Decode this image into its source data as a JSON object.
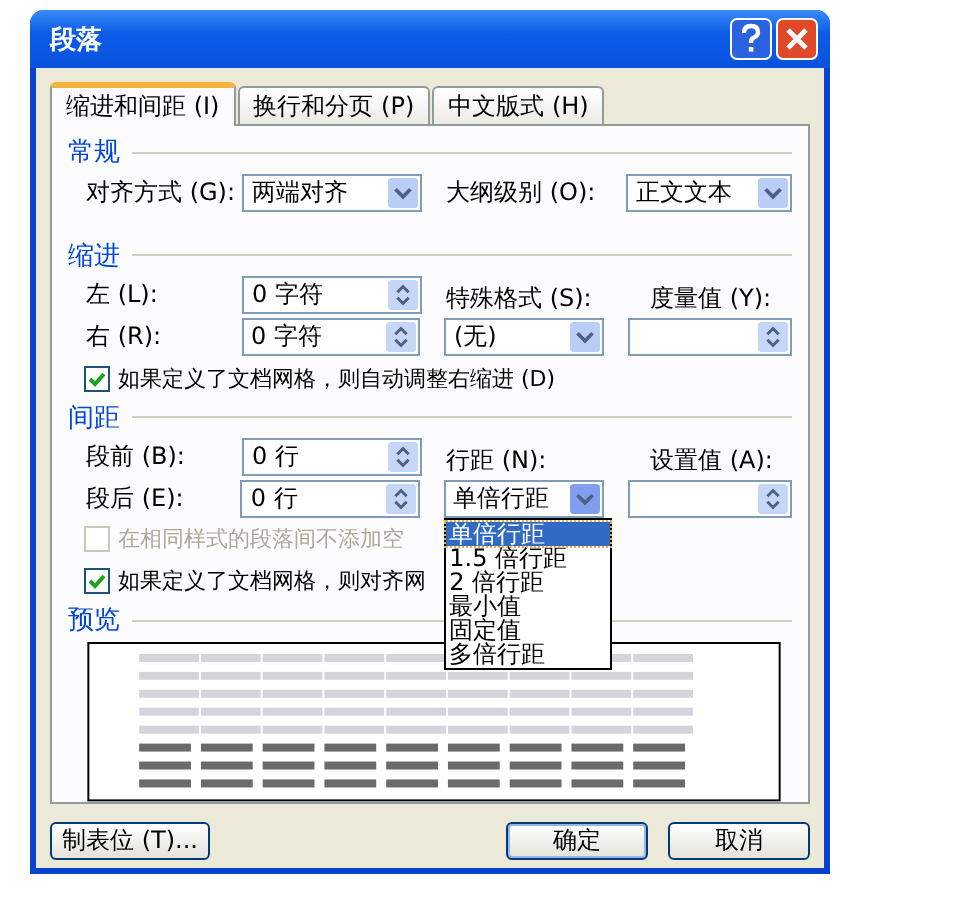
{
  "window": {
    "title": "段落"
  },
  "tabs": [
    {
      "label": "缩进和间距 (I)",
      "selected": true
    },
    {
      "label": "换行和分页 (P)",
      "selected": false
    },
    {
      "label": "中文版式 (H)",
      "selected": false
    }
  ],
  "general": {
    "heading": "常规",
    "alignment": {
      "label": "对齐方式 (G):",
      "value": "两端对齐"
    },
    "outline_level": {
      "label": "大纲级别 (O):",
      "value": "正文文本"
    }
  },
  "indent": {
    "heading": "缩进",
    "left": {
      "label": "左 (L):",
      "value": "0 字符"
    },
    "right": {
      "label": "右 (R):",
      "value": "0 字符"
    },
    "special": {
      "label": "特殊格式 (S):",
      "value": "(无)"
    },
    "by": {
      "label": "度量值 (Y):"
    },
    "auto_adjust": {
      "label": "如果定义了文档网格，则自动调整右缩进 (D)",
      "checked": true
    }
  },
  "spacing": {
    "heading": "间距",
    "before": {
      "label": "段前 (B):",
      "value": "0 行"
    },
    "after": {
      "label": "段后 (E):",
      "value": "0 行"
    },
    "line_spacing": {
      "label": "行距 (N):",
      "value": "单倍行距",
      "expanded": true,
      "options": [
        {
          "label": "单倍行距",
          "selected": true
        },
        {
          "label": "1.5 倍行距",
          "selected": false
        },
        {
          "label": "2 倍行距",
          "selected": false
        },
        {
          "label": "最小值",
          "selected": false
        },
        {
          "label": "固定值",
          "selected": false
        },
        {
          "label": "多倍行距",
          "selected": false
        }
      ]
    },
    "at": {
      "label": "设置值 (A):"
    },
    "no_space": {
      "label": "在相同样式的段落间不添加空",
      "checked": false,
      "disabled": true
    },
    "snap": {
      "label": "如果定义了文档网格，则对齐网",
      "checked": true
    }
  },
  "preview": {
    "heading": "预览"
  },
  "buttons": {
    "tabs": "制表位 (T)...",
    "ok": "确定",
    "cancel": "取消"
  }
}
